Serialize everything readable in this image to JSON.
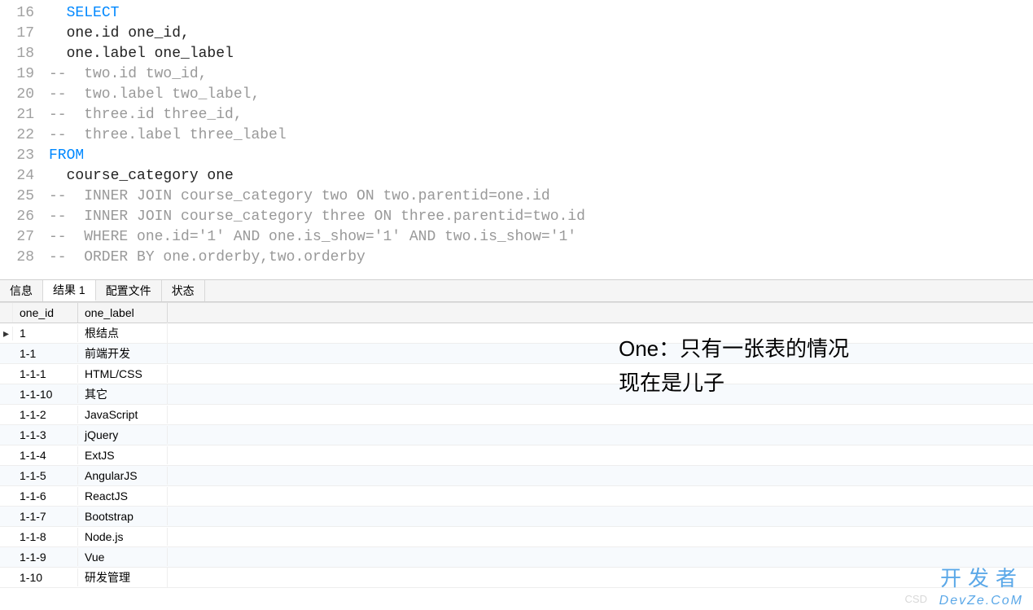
{
  "editor": {
    "lines": [
      {
        "num": "16",
        "segments": [
          {
            "cls": "kw-black",
            "text": "  "
          },
          {
            "cls": "keyword",
            "text": "SELECT"
          }
        ]
      },
      {
        "num": "17",
        "segments": [
          {
            "cls": "kw-black",
            "text": "  one.id one_id,"
          }
        ]
      },
      {
        "num": "18",
        "segments": [
          {
            "cls": "kw-black",
            "text": "  one.label one_label"
          }
        ]
      },
      {
        "num": "19",
        "segments": [
          {
            "cls": "comment",
            "text": "--  two.id two_id,"
          }
        ]
      },
      {
        "num": "20",
        "segments": [
          {
            "cls": "comment",
            "text": "--  two.label two_label,"
          }
        ]
      },
      {
        "num": "21",
        "segments": [
          {
            "cls": "comment",
            "text": "--  three.id three_id,"
          }
        ]
      },
      {
        "num": "22",
        "segments": [
          {
            "cls": "comment",
            "text": "--  three.label three_label"
          }
        ]
      },
      {
        "num": "23",
        "segments": [
          {
            "cls": "keyword",
            "text": "FROM"
          }
        ]
      },
      {
        "num": "24",
        "segments": [
          {
            "cls": "kw-black",
            "text": "  course_category one"
          }
        ]
      },
      {
        "num": "25",
        "segments": [
          {
            "cls": "comment",
            "text": "--  INNER JOIN course_category two ON two.parentid=one.id"
          }
        ]
      },
      {
        "num": "26",
        "segments": [
          {
            "cls": "comment",
            "text": "--  INNER JOIN course_category three ON three.parentid=two.id"
          }
        ]
      },
      {
        "num": "27",
        "segments": [
          {
            "cls": "comment",
            "text": "--  WHERE one.id='1' AND one.is_show='1' AND two.is_show='1'"
          }
        ]
      },
      {
        "num": "28",
        "segments": [
          {
            "cls": "comment",
            "text": "--  ORDER BY one.orderby,two.orderby"
          }
        ]
      }
    ]
  },
  "tabs": {
    "items": [
      {
        "label": "信息",
        "active": false
      },
      {
        "label": "结果 1",
        "active": true
      },
      {
        "label": "配置文件",
        "active": false
      },
      {
        "label": "状态",
        "active": false
      }
    ]
  },
  "grid": {
    "headers": [
      "one_id",
      "one_label"
    ],
    "rows": [
      {
        "marker": "▸",
        "cells": [
          "1",
          "根结点"
        ]
      },
      {
        "marker": "",
        "cells": [
          "1-1",
          "前端开发"
        ]
      },
      {
        "marker": "",
        "cells": [
          "1-1-1",
          "HTML/CSS"
        ]
      },
      {
        "marker": "",
        "cells": [
          "1-1-10",
          "其它"
        ]
      },
      {
        "marker": "",
        "cells": [
          "1-1-2",
          "JavaScript"
        ]
      },
      {
        "marker": "",
        "cells": [
          "1-1-3",
          "jQuery"
        ]
      },
      {
        "marker": "",
        "cells": [
          "1-1-4",
          "ExtJS"
        ]
      },
      {
        "marker": "",
        "cells": [
          "1-1-5",
          "AngularJS"
        ]
      },
      {
        "marker": "",
        "cells": [
          "1-1-6",
          "ReactJS"
        ]
      },
      {
        "marker": "",
        "cells": [
          "1-1-7",
          "Bootstrap"
        ]
      },
      {
        "marker": "",
        "cells": [
          "1-1-8",
          "Node.js"
        ]
      },
      {
        "marker": "",
        "cells": [
          "1-1-9",
          "Vue"
        ]
      },
      {
        "marker": "",
        "cells": [
          "1-10",
          "研发管理"
        ]
      }
    ]
  },
  "annotation": {
    "line1": "One：只有一张表的情况",
    "line2": "现在是儿子"
  },
  "watermark": {
    "cn": "开发者",
    "en": "DevZe.CoM",
    "csdn": "CSD"
  }
}
